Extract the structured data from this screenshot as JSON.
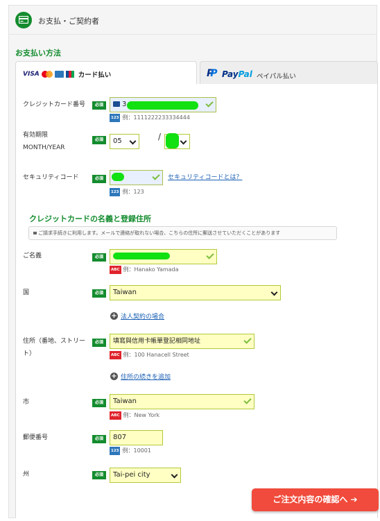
{
  "header": {
    "title": "お支払・ご契約者",
    "icon": "credit-card-icon"
  },
  "payment_method_heading": "お支払い方法",
  "tabs": {
    "card": {
      "label": "カード払い",
      "logos": {
        "visa": "VISA"
      }
    },
    "paypal": {
      "logo_p": "P",
      "logo_pay": "Pay",
      "logo_pal": "Pal",
      "label": "ペイパル払い"
    }
  },
  "card": {
    "number": {
      "label": "クレジットカード番号",
      "required": "必須",
      "value": "3",
      "hint": "例：1111222233334444",
      "badge": "123"
    },
    "expiry": {
      "label_line1": "有効期限",
      "label_line2": "MONTH/YEAR",
      "required": "必須",
      "month": "05",
      "separator": "/"
    },
    "security": {
      "label": "セキュリティコード",
      "required": "必須",
      "hint": "例：123",
      "badge": "123",
      "link": "セキュリティコードとは？"
    }
  },
  "holder_heading": "クレジットカードの名義と登録住所",
  "notice": "ご請求手続きに利用します。メールで連絡が取れない場合、こちらの住所に郵送させていただくことがあります",
  "fields": {
    "name": {
      "label": "ご名義",
      "required": "必須",
      "hint": "例：Hanako Yamada",
      "badge": "ABC"
    },
    "country": {
      "label": "国",
      "required": "必須",
      "value": "Taiwan"
    },
    "corporate_link": "法人契約の場合",
    "address": {
      "label_line1": "住所（番地、ストリー",
      "label_line2": "ト）",
      "required": "必須",
      "value": "填寫與信用卡帳單登記相同地址",
      "hint": "例：100 Hanacell Street",
      "badge": "ABC"
    },
    "address_more_link": "住所の続きを追加",
    "city": {
      "label": "市",
      "required": "必須",
      "value": "Taiwan",
      "hint": "例：New York",
      "badge": "ABC"
    },
    "postal": {
      "label": "郵便番号",
      "required": "必須",
      "value": "807",
      "hint": "例：10001",
      "badge": "123"
    },
    "state": {
      "label": "州",
      "required": "必須",
      "value": "Tai-pei city"
    }
  },
  "confirm_button": "ご注文内容の確認へ ➔",
  "colors": {
    "accent_green": "#148c2e",
    "field_fill": "#ffffc4",
    "confirm_red": "#f04b3c"
  }
}
